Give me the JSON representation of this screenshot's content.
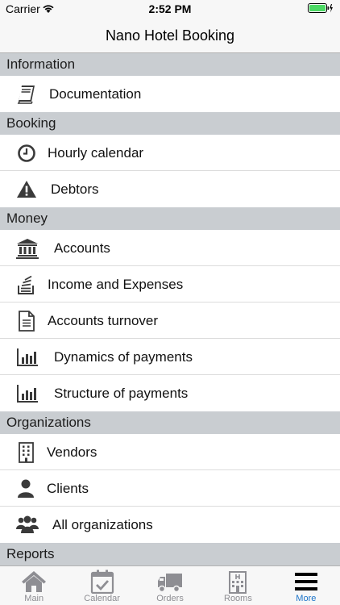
{
  "status_bar": {
    "carrier": "Carrier",
    "time": "2:52 PM"
  },
  "nav": {
    "title": "Nano Hotel Booking"
  },
  "sections": [
    {
      "header": "Information",
      "items": [
        {
          "label": "Documentation",
          "icon": "book-icon"
        }
      ]
    },
    {
      "header": "Booking",
      "items": [
        {
          "label": "Hourly calendar",
          "icon": "clock-icon"
        },
        {
          "label": "Debtors",
          "icon": "warning-icon"
        }
      ]
    },
    {
      "header": "Money",
      "items": [
        {
          "label": "Accounts",
          "icon": "bank-icon"
        },
        {
          "label": "Income and Expenses",
          "icon": "stack-coins-icon"
        },
        {
          "label": "Accounts turnover",
          "icon": "document-icon"
        },
        {
          "label": "Dynamics of payments",
          "icon": "bar-chart-icon"
        },
        {
          "label": "Structure of payments",
          "icon": "bar-chart-icon"
        }
      ]
    },
    {
      "header": "Organizations",
      "items": [
        {
          "label": "Vendors",
          "icon": "building-icon"
        },
        {
          "label": "Clients",
          "icon": "user-icon"
        },
        {
          "label": "All organizations",
          "icon": "users-icon"
        }
      ]
    },
    {
      "header": "Reports",
      "items": []
    }
  ],
  "tabs": [
    {
      "label": "Main",
      "icon": "home-icon",
      "active": false
    },
    {
      "label": "Calendar",
      "icon": "calendar-check-icon",
      "active": false
    },
    {
      "label": "Orders",
      "icon": "truck-icon",
      "active": false
    },
    {
      "label": "Rooms",
      "icon": "hotel-icon",
      "active": false
    },
    {
      "label": "More",
      "icon": "menu-icon",
      "active": true
    }
  ],
  "colors": {
    "section_bg": "#c9cdd1",
    "active_tab": "#1a73c9",
    "inactive_tab": "#8e8e93",
    "icon": "#3a3a3a"
  }
}
